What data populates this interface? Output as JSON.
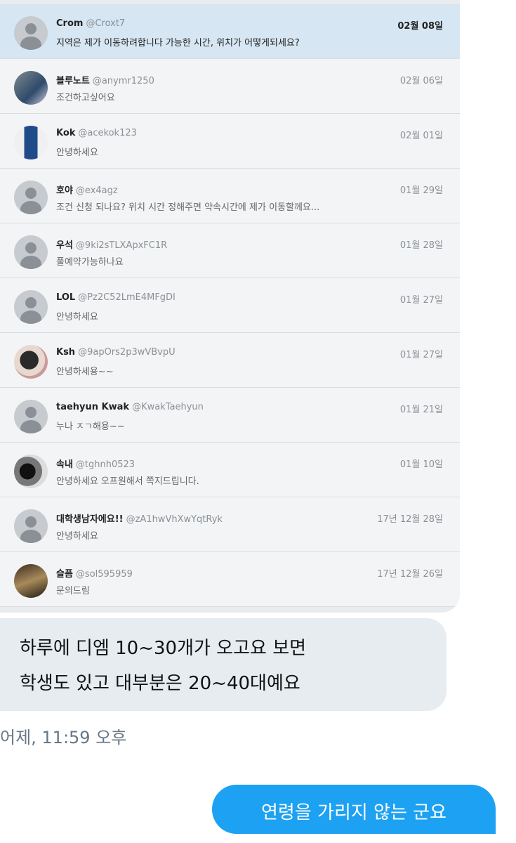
{
  "dm_list": [
    {
      "name": "Crom",
      "handle": "@Croxt7",
      "date": "02월 08일",
      "message": "지역은 제가 이동하려합니다  가능한 시간, 위치가 어떻게되세요?",
      "avatar": "default-avatar-icon",
      "unread": true
    },
    {
      "name": "블루노트",
      "handle": "@anymr1250",
      "date": "02월 06일",
      "message": "조건하고싶어요",
      "avatar": "profile-photo",
      "unread": false
    },
    {
      "name": "Kok",
      "handle": "@acekok123",
      "date": "02월 01일",
      "message": "안녕하세요",
      "avatar": "profile-photo",
      "unread": false
    },
    {
      "name": "호야",
      "handle": "@ex4agz",
      "date": "01월 29일",
      "message": "조건 신청 되나요? 위치 시간 정해주면 약속시간에   제가 이동할께요...",
      "avatar": "default-avatar-icon",
      "unread": false
    },
    {
      "name": "우석",
      "handle": "@9ki2sTLXApxFC1R",
      "date": "01월 28일",
      "message": "풀예약가능하나요",
      "avatar": "default-avatar-icon",
      "unread": false
    },
    {
      "name": "LOL",
      "handle": "@Pz2C52LmE4MFgDI",
      "date": "01월 27일",
      "message": "안녕하세요",
      "avatar": "default-avatar-icon",
      "unread": false
    },
    {
      "name": "Ksh",
      "handle": "@9apOrs2p3wVBvpU",
      "date": "01월 27일",
      "message": "안녕하세용~~",
      "avatar": "profile-photo",
      "unread": false
    },
    {
      "name": "taehyun Kwak",
      "handle": "@KwakTaehyun",
      "date": "01월 21일",
      "message": "누나 ㅈㄱ해용~~",
      "avatar": "default-avatar-icon",
      "unread": false
    },
    {
      "name": "속내",
      "handle": "@tghnh0523",
      "date": "01월 10일",
      "message": "안녕하세요 오프원해서 쪽지드립니다.",
      "avatar": "profile-photo",
      "unread": false
    },
    {
      "name": "대학생남자에요!!",
      "handle": "@zA1hwVhXwYqtRyk",
      "date": "17년 12월 28일",
      "message": "안녕하세요",
      "avatar": "default-avatar-icon",
      "unread": false
    },
    {
      "name": "슬픔",
      "handle": "@sol595959",
      "date": "17년 12월 26일",
      "message": "문의드림",
      "avatar": "profile-photo",
      "unread": false
    }
  ],
  "chat": {
    "incoming_line1": "하루에 디엠 10~30개가 오고요 보면",
    "incoming_line2": "학생도 있고 대부분은 20~40대예요",
    "timestamp": "어제, 11:59 오후",
    "outgoing": "연령을 가리지 않는 군요"
  },
  "colors": {
    "outgoing_bubble": "#1da1f2",
    "incoming_bubble": "#e6ecf0",
    "unread_row": "#d6e6f2"
  }
}
